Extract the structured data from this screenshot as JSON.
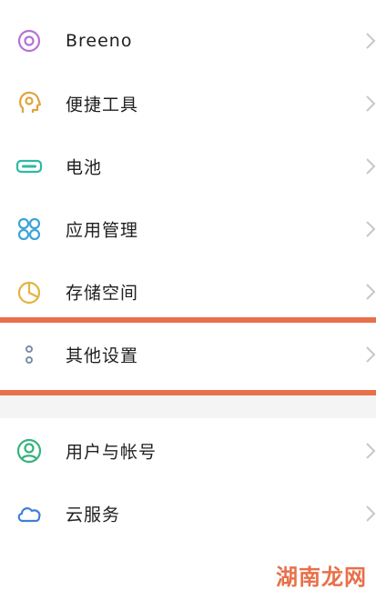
{
  "settings_group_1": [
    {
      "label": "Breeno",
      "icon": "breeno-ring-icon"
    },
    {
      "label": "便捷工具",
      "icon": "convenience-tools-head-icon"
    },
    {
      "label": "电池",
      "icon": "battery-icon"
    },
    {
      "label": "应用管理",
      "icon": "app-management-grid-icon"
    },
    {
      "label": "存储空间",
      "icon": "storage-pie-icon"
    },
    {
      "label": "其他设置",
      "icon": "other-settings-dots-icon"
    }
  ],
  "settings_group_2": [
    {
      "label": "用户与帐号",
      "icon": "user-account-icon"
    },
    {
      "label": "云服务",
      "icon": "cloud-service-icon"
    }
  ],
  "highlight_color": "#e8704a",
  "watermark": {
    "text": "湖南龙网",
    "color": "#e8704a"
  }
}
